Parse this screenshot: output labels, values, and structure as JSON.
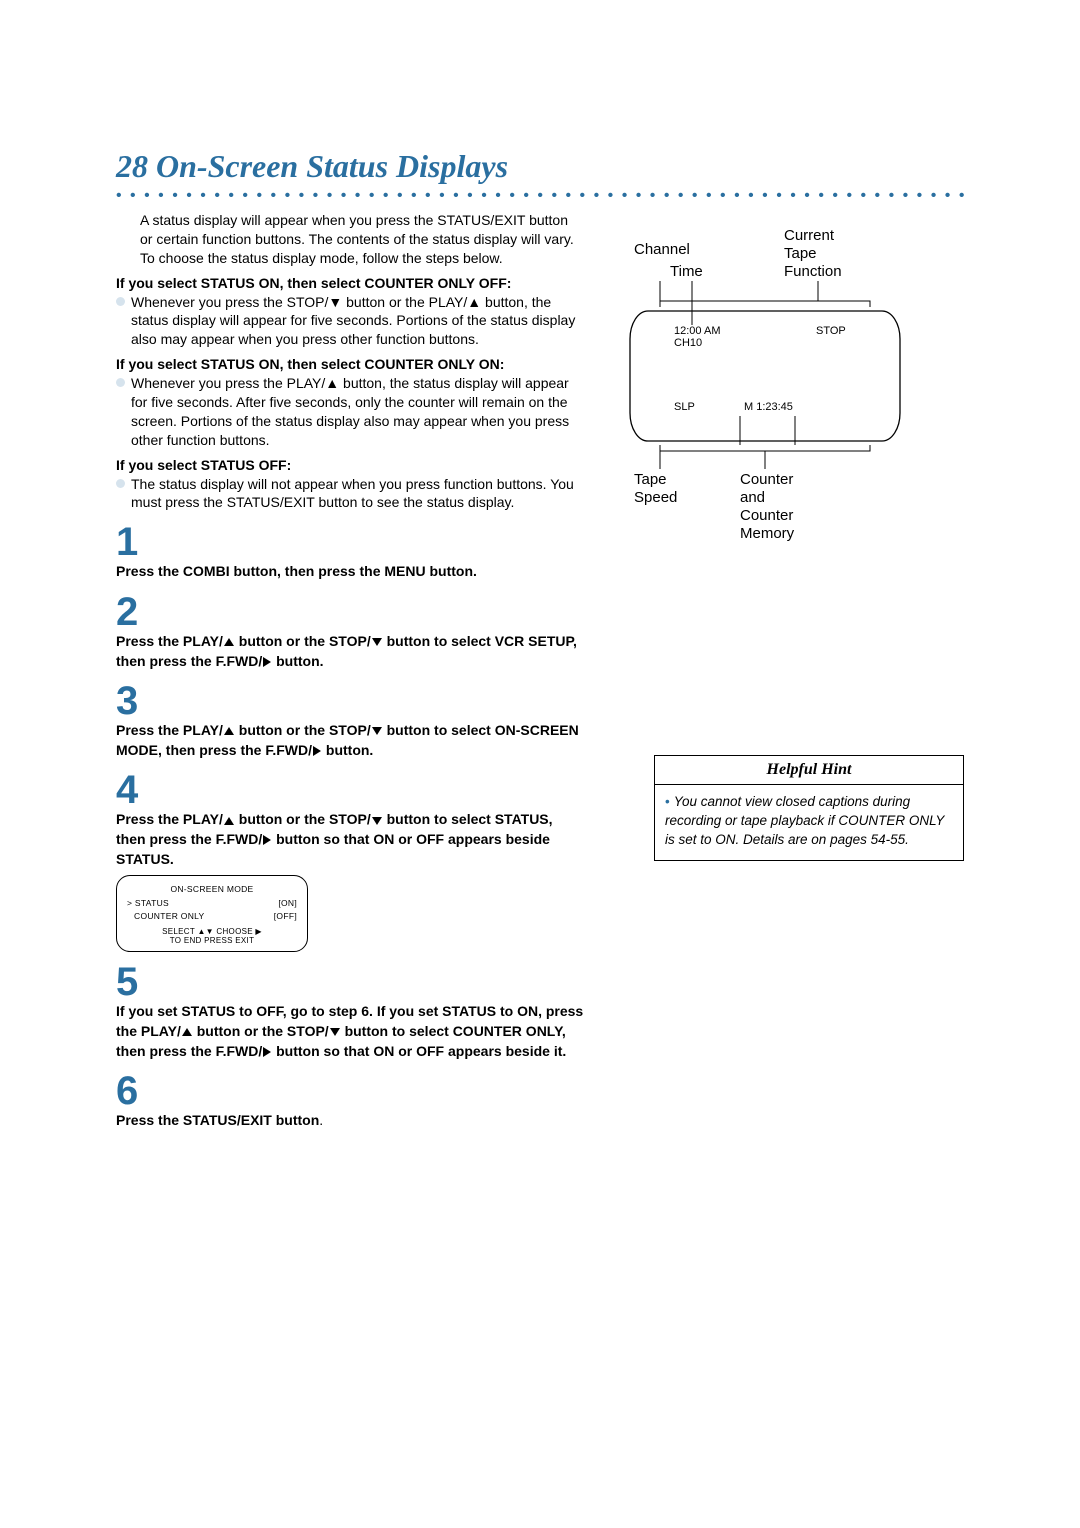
{
  "page_number": "28",
  "title": "On-Screen Status Displays",
  "intro": "A status display will appear when you press the STATUS/EXIT button or certain function buttons. The contents of the status display will vary. To choose the status display mode, follow the steps below.",
  "cond1_head": "If you select STATUS ON, then select COUNTER ONLY OFF:",
  "cond1_body": "Whenever you press the STOP/▼ button or the PLAY/▲ button, the status display will appear for five seconds. Portions of the status display also may appear when you press other function buttons.",
  "cond2_head": "If you select STATUS ON, then select COUNTER ONLY ON:",
  "cond2_body": "Whenever you press the PLAY/▲ button, the status display will appear for five seconds. After five seconds, only the counter will remain on the screen. Portions of the status display also may appear when you press other function buttons.",
  "cond3_head": "If you select STATUS OFF:",
  "cond3_body": "The status display will not appear when you press function buttons. You must press the STATUS/EXIT button to see the status display.",
  "steps": {
    "s1": "Press the COMBI button, then press the MENU button.",
    "s2a": "Press the PLAY/",
    "s2b": " button or the STOP/",
    "s2c": " button to select VCR SETUP, then press the F.FWD/",
    "s2d": " button.",
    "s3a": "Press the PLAY/",
    "s3b": " button or the STOP/",
    "s3c": " button to select ON-SCREEN MODE, then press the F.FWD/",
    "s3d": " button.",
    "s4a": "Press the PLAY/",
    "s4b": " button or the STOP/",
    "s4c": " button to select STATUS, then press the F.FWD/",
    "s4d": " button so that ON or OFF appears beside STATUS.",
    "s5a": "If you set STATUS to OFF, go to step 6. If you set STATUS to ON, press the PLAY/",
    "s5b": " button or the STOP/",
    "s5c": " button to select COUNTER ONLY, then press the F.FWD/",
    "s5d": " button so that ON or OFF appears beside it.",
    "s6": "Press the STATUS/EXIT button"
  },
  "osd": {
    "title": "ON-SCREEN MODE",
    "row1_l": "> STATUS",
    "row1_r": "[ON]",
    "row2_l": "COUNTER ONLY",
    "row2_r": "[OFF]",
    "f1": "SELECT ▲▼ CHOOSE ▶",
    "f2": "TO END PRESS EXIT"
  },
  "tv_labels": {
    "channel": "Channel",
    "time": "Time",
    "current": "Current",
    "tape": "Tape",
    "function": "Function",
    "tapespeed1": "Tape",
    "tapespeed2": "Speed",
    "counter1": "Counter",
    "counter2": "and",
    "counter3": "Counter",
    "counter4": "Memory"
  },
  "tv_values": {
    "clock": "12:00 AM",
    "ch": "CH10",
    "stop": "STOP",
    "slp": "SLP",
    "mem": "M  1:23:45"
  },
  "hint": {
    "title": "Helpful Hint",
    "body": "You cannot view closed captions during recording or tape playback if COUNTER ONLY is set to ON. Details are on pages 54-55."
  }
}
